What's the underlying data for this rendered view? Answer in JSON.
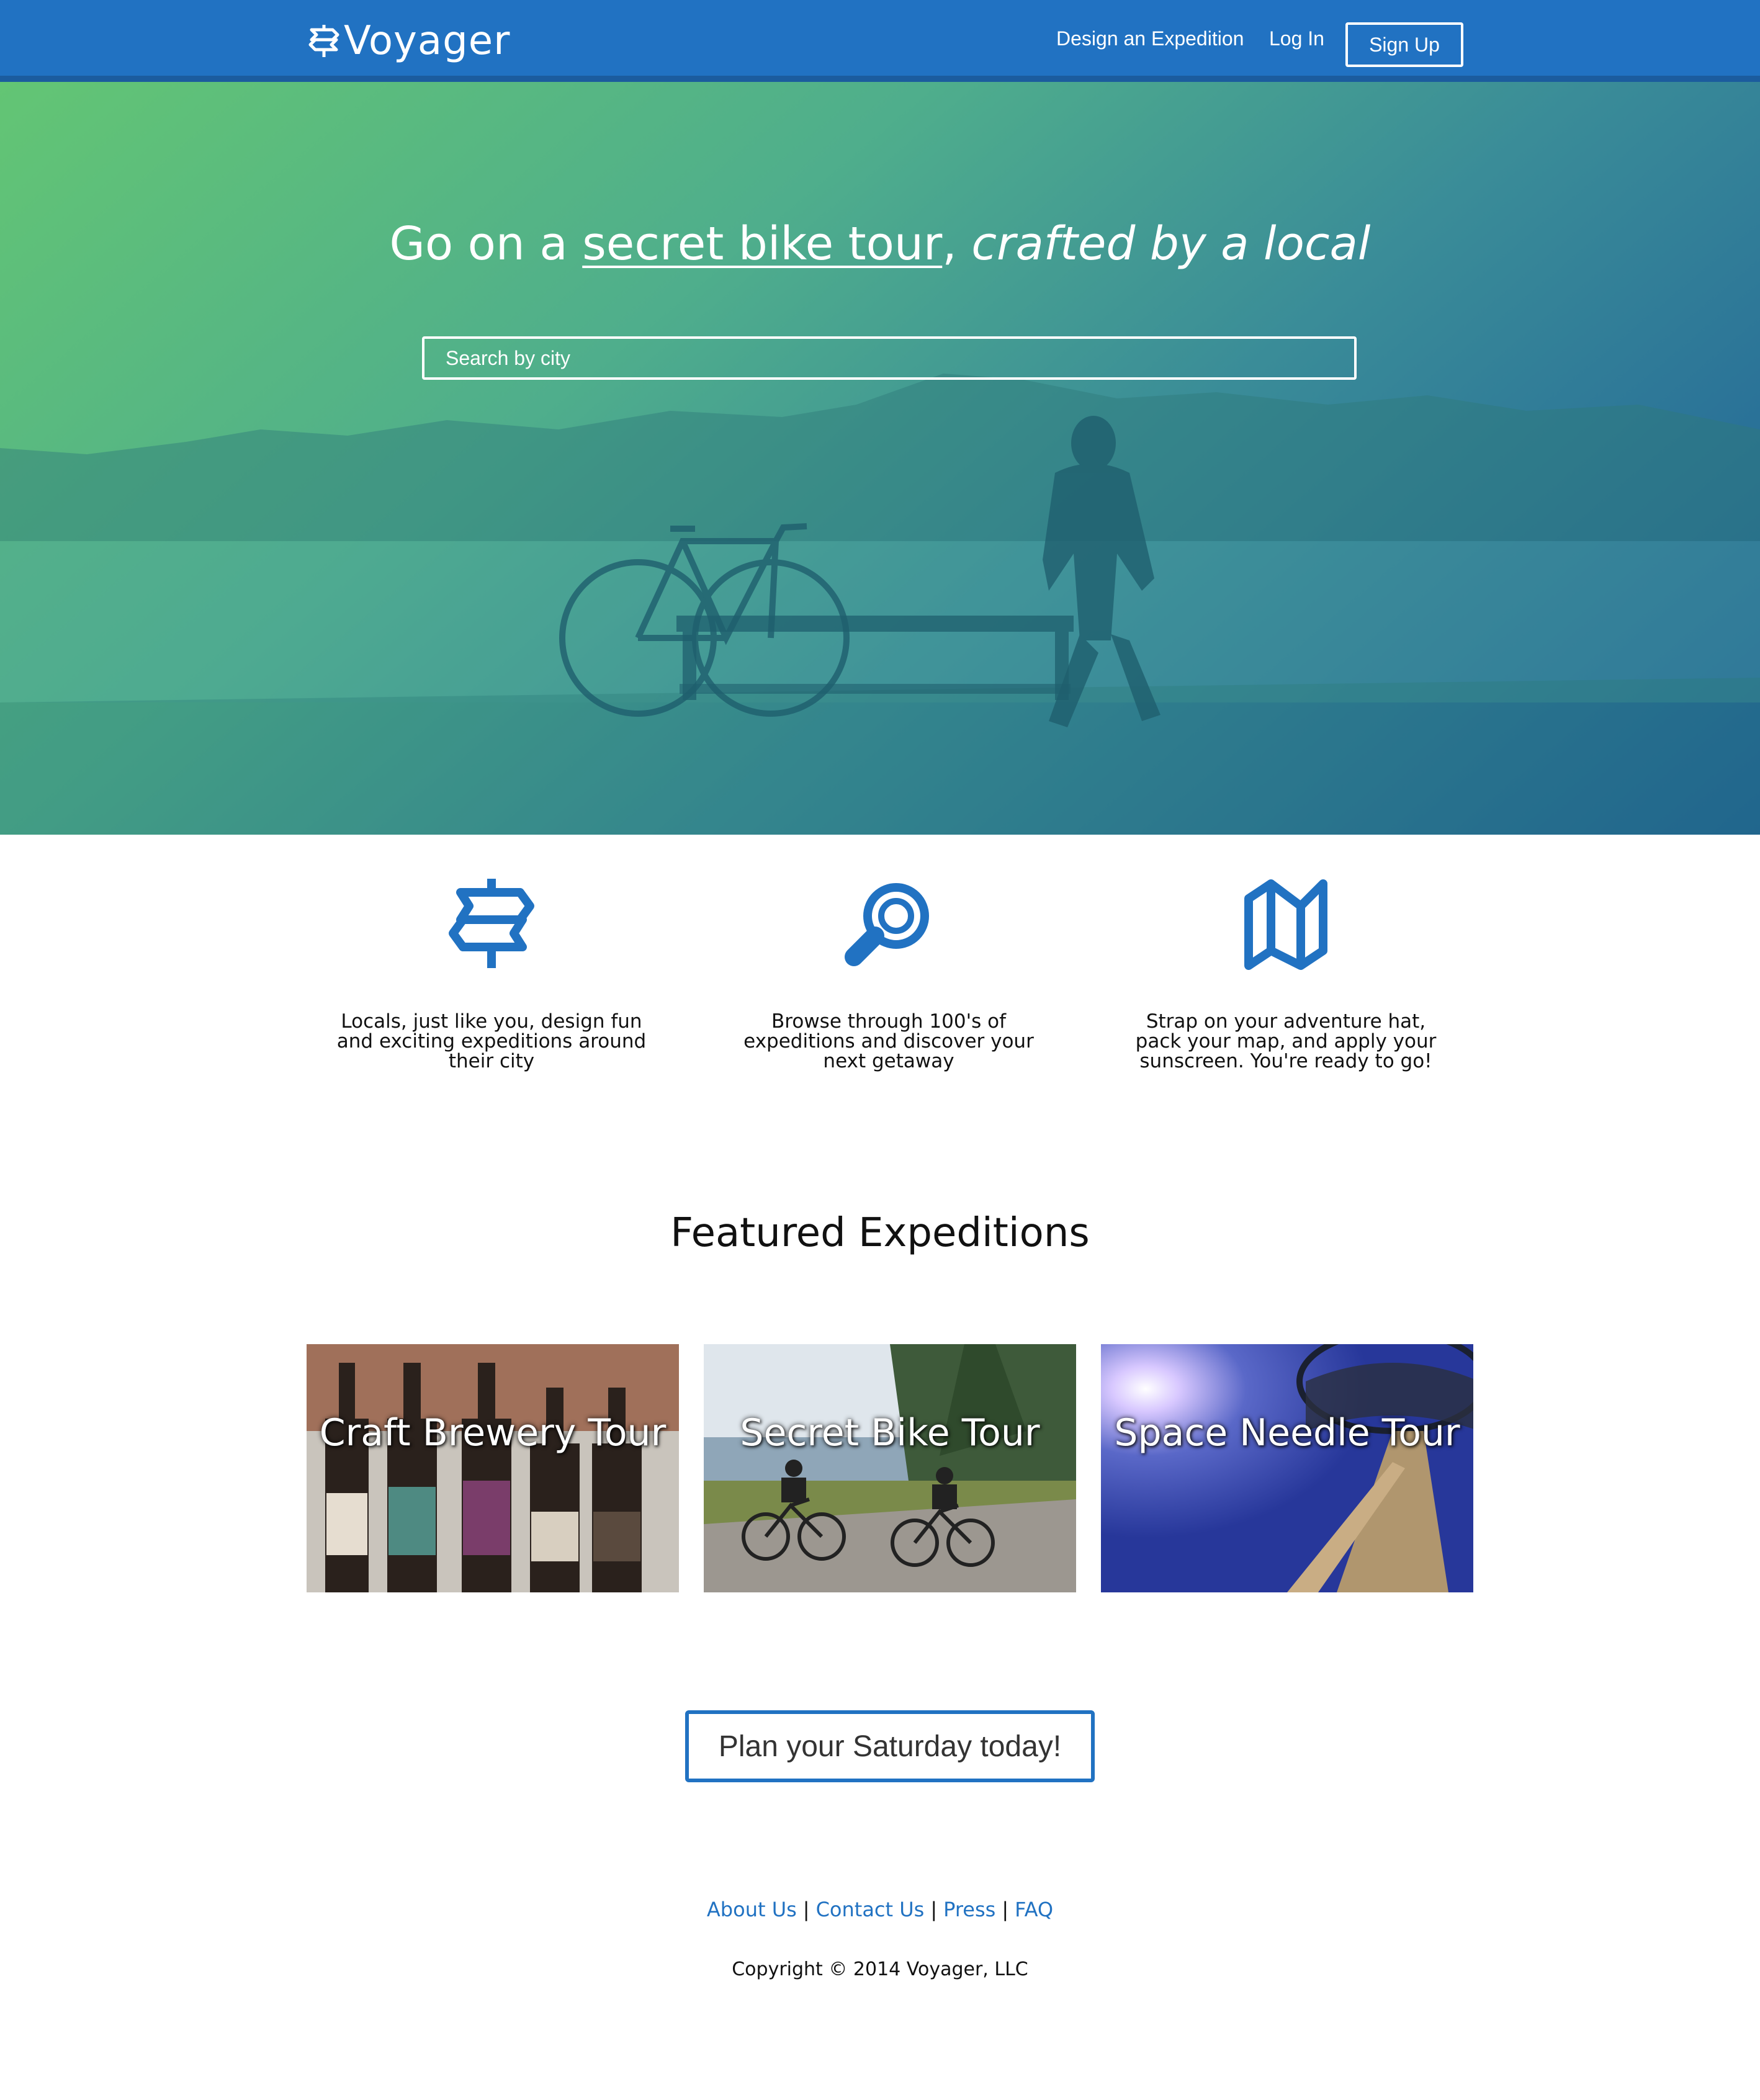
{
  "navbar": {
    "brand": "Voyager",
    "links": [
      {
        "label": "Design an Expedition"
      },
      {
        "label": "Log In"
      }
    ],
    "signup_label": "Sign Up"
  },
  "hero": {
    "title_prefix": "Go on a ",
    "title_underlined": "secret bike tour",
    "title_comma": ", ",
    "title_italic": "crafted by a local",
    "search_placeholder": "Search by city"
  },
  "features": [
    {
      "icon": "signpost-icon",
      "text": "Locals, just like you, design fun\nand exciting expeditions around\ntheir city"
    },
    {
      "icon": "search-icon",
      "text": "Browse through 100's of\nexpeditions and discover your\nnext getaway"
    },
    {
      "icon": "map-icon",
      "text": "Strap on your adventure hat,\npack your map, and apply your\nsunscreen. You're ready to go!"
    }
  ],
  "featured": {
    "title": "Featured Expeditions",
    "cards": [
      {
        "label": "Craft Brewery Tour"
      },
      {
        "label": "Secret Bike Tour"
      },
      {
        "label": "Space Needle Tour"
      }
    ]
  },
  "cta": {
    "label": "Plan your Saturday today!"
  },
  "footer": {
    "links": [
      "About Us",
      "Contact Us",
      "Press",
      "FAQ"
    ],
    "separator": "|",
    "copyright": "Copyright © 2014 Voyager, LLC"
  },
  "colors": {
    "primary": "#2172c2",
    "hero_start": "#63c574",
    "hero_end": "#1c5b98"
  }
}
